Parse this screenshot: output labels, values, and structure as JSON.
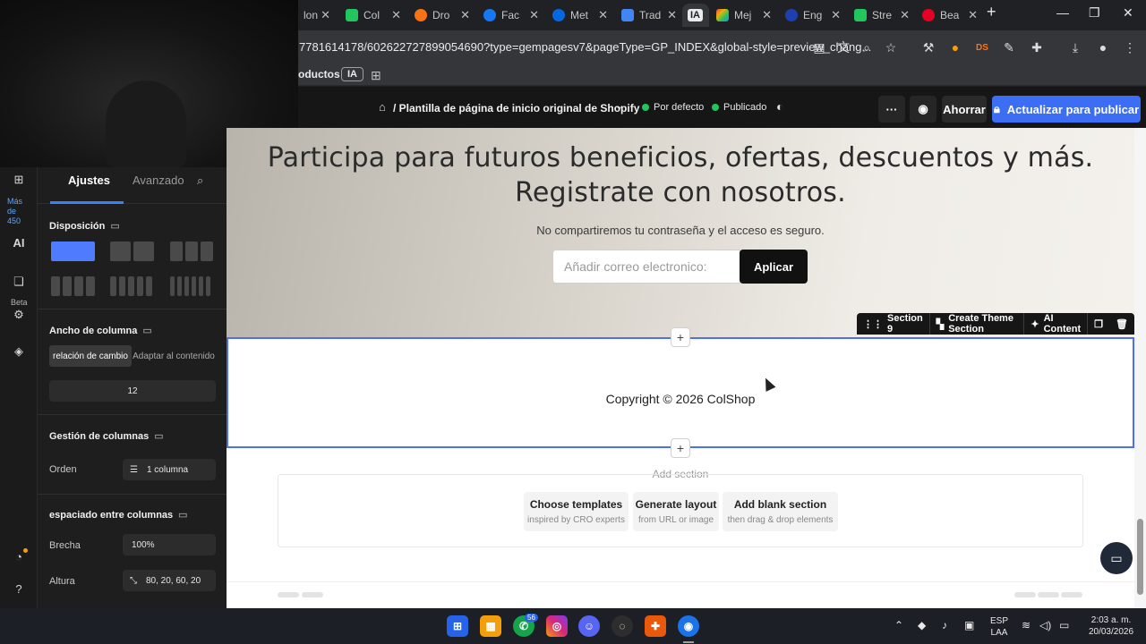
{
  "browser": {
    "tabs": [
      {
        "label": "lon"
      },
      {
        "label": "Col"
      },
      {
        "label": "Dro"
      },
      {
        "label": "Fac"
      },
      {
        "label": "Met"
      },
      {
        "label": "Trad"
      },
      {
        "label": "IA"
      },
      {
        "label": "Mej"
      },
      {
        "label": "Eng"
      },
      {
        "label": "Stre"
      },
      {
        "label": "Bea"
      }
    ],
    "url": "7781614178/602622727899054690?type=gempagesv7&pageType=GP_INDEX&global-style=preview_chang...",
    "bookmarks": {
      "productos": "oductos",
      "ia": "IA"
    }
  },
  "editor": {
    "breadcrumb": "/ Plantilla de página de inicio original de Shopify",
    "badge_default": "Por defecto",
    "badge_published": "Publicado",
    "save_label": "Ahorrar",
    "publish_label": "Actualizar para publicar"
  },
  "rail": {
    "more_text": [
      "Más",
      "de",
      "450"
    ],
    "ai_label": "AI",
    "beta_label": "Beta"
  },
  "panel": {
    "tab_settings": "Ajustes",
    "tab_advanced": "Avanzado",
    "layout_heading": "Disposición",
    "column_width_heading": "Ancho de columna",
    "ratio_label": "relación de cambio",
    "fit_label": "Adaptar al contenido",
    "column_value": "12",
    "column_mgmt_heading": "Gestión de columnas",
    "order_label": "Orden",
    "order_value": "1 columna",
    "spacing_heading": "espaciado entre columnas",
    "gap_label": "Brecha",
    "gap_value": "100%",
    "height_label": "Altura",
    "height_value": "80, 20, 60, 20"
  },
  "canvas": {
    "hero_line1": "Participa para futuros beneficios, ofertas, descuentos y más.",
    "hero_line2": "Registrate con nosotros.",
    "hero_sub": "No compartiremos tu contraseña y el acceso es seguro.",
    "email_placeholder": "Añadir correo electronico:",
    "apply_label": "Aplicar",
    "section_name": "Section 9",
    "create_theme_section": "Create Theme Section",
    "ai_content": "AI Content",
    "copyright": "Copyright © 2026 ColShop",
    "add_section": "Add section",
    "options": [
      {
        "title": "Choose templates",
        "subtitle": "inspired by CRO experts"
      },
      {
        "title": "Generate layout",
        "subtitle": "from URL or image"
      },
      {
        "title": "Add blank section",
        "subtitle": "then drag & drop elements"
      }
    ]
  },
  "taskbar": {
    "whatsapp_badge": "56",
    "lang_top": "ESP",
    "lang_bottom": "LAA",
    "time": "2:03 a. m.",
    "date": "20/03/2026"
  },
  "colors": {
    "accent": "#4f6ef7",
    "publish": "#3b6ef5",
    "status_green": "#22c55e"
  }
}
